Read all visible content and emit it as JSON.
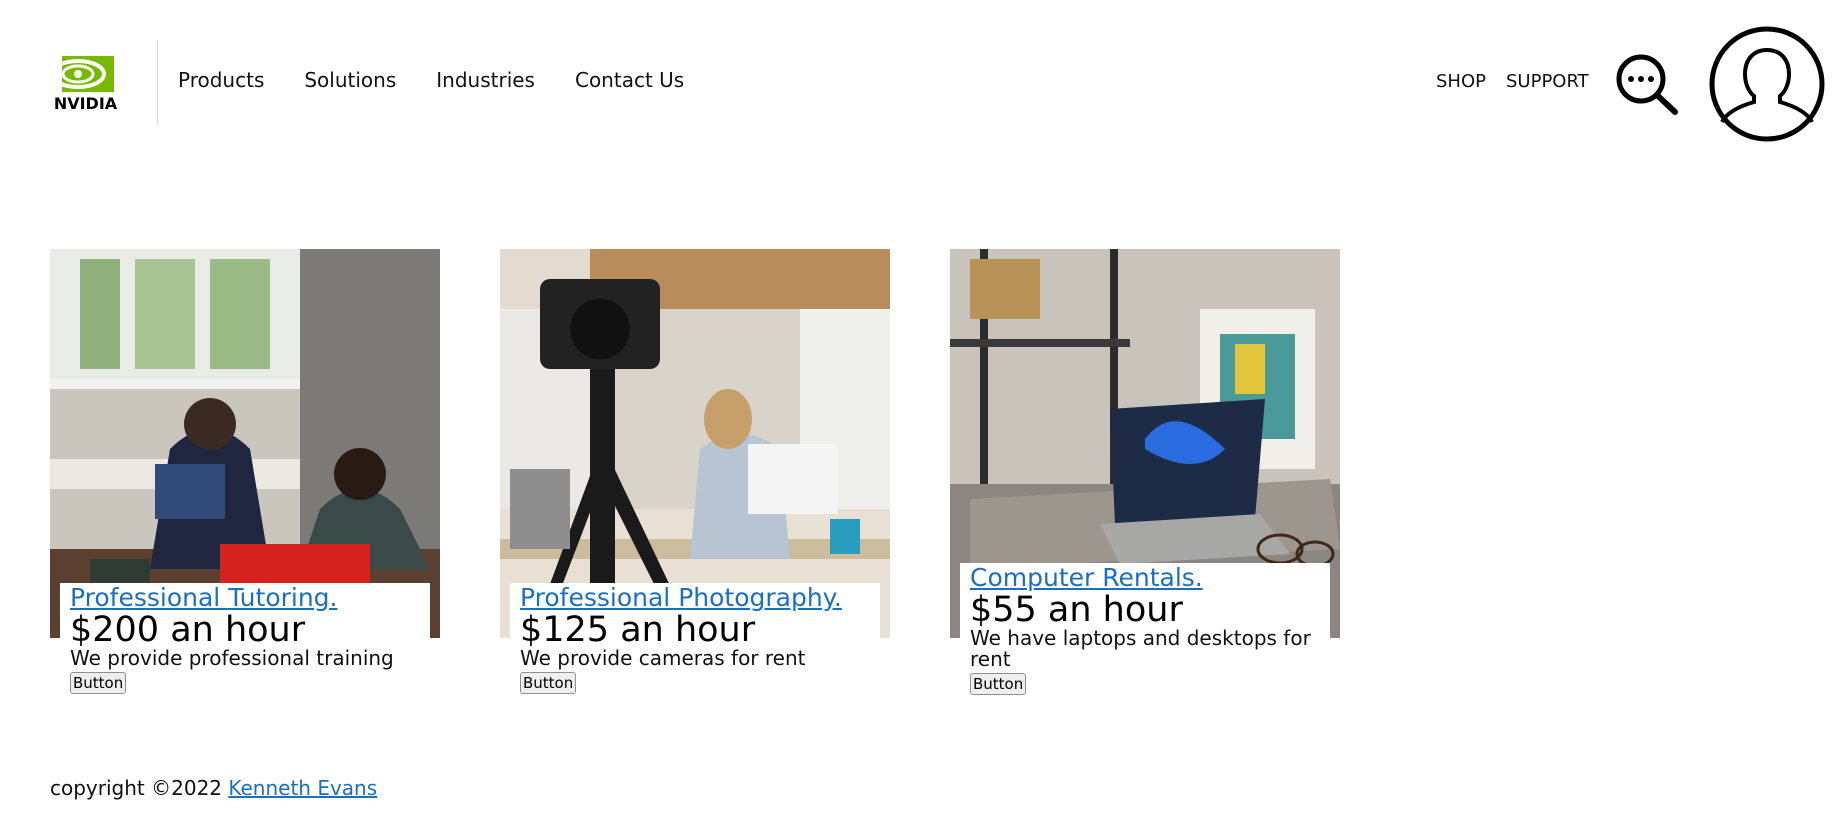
{
  "header": {
    "logo_text": "NVIDIA",
    "nav": [
      "Products",
      "Solutions",
      "Industries",
      "Contact Us"
    ],
    "shop_label": "SHOP",
    "support_label": "SUPPORT"
  },
  "cards": [
    {
      "title": "Professional Tutoring.",
      "price": "$200 an hour",
      "description": "We provide professional training",
      "button_label": "Button"
    },
    {
      "title": "Professional Photography.",
      "price": "$125 an hour",
      "description": "We provide cameras for rent",
      "button_label": "Button"
    },
    {
      "title": "Computer Rentals.",
      "price": "$55 an hour",
      "description": "We have laptops and desktops for rent",
      "button_label": "Button"
    }
  ],
  "footer": {
    "copyright": "copyright ©2022",
    "author": "Kenneth Evans"
  },
  "colors": {
    "link": "#1a6fbf",
    "brand_green": "#76b900"
  }
}
